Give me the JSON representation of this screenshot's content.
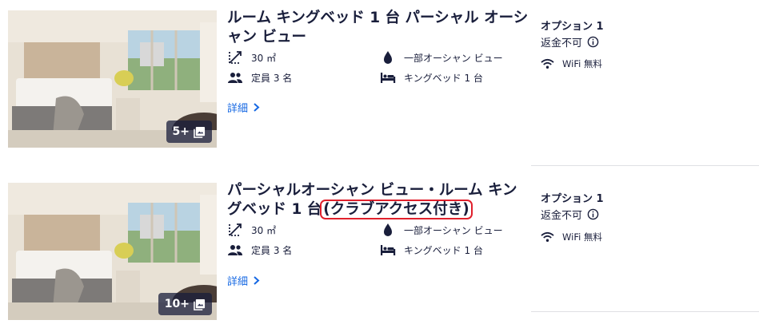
{
  "rooms": [
    {
      "title": "ルーム キングベッド 1 台 パーシャル オーシャン ビュー",
      "title_highlight": "",
      "photo_count": "5+",
      "size": "30 ㎡",
      "view": "一部オーシャン ビュー",
      "occupancy": "定員 3 名",
      "bed": "キングベッド 1 台",
      "details_link": "詳細",
      "option_label": "オプション 1",
      "refund": "返金不可",
      "amenity": "WiFi 無料"
    },
    {
      "title": "パーシャルオーシャン ビュー・ルーム キングベッド 1 台",
      "title_highlight": "(クラブアクセス付き)",
      "photo_count": "10+",
      "size": "30 ㎡",
      "view": "一部オーシャン ビュー",
      "occupancy": "定員 3 名",
      "bed": "キングベッド 1 台",
      "details_link": "詳細",
      "option_label": "オプション 1",
      "refund": "返金不可",
      "amenity": "WiFi 無料"
    }
  ],
  "colors": {
    "text": "#191e3b",
    "link": "#1668e3",
    "highlight_border": "#e0202c"
  }
}
